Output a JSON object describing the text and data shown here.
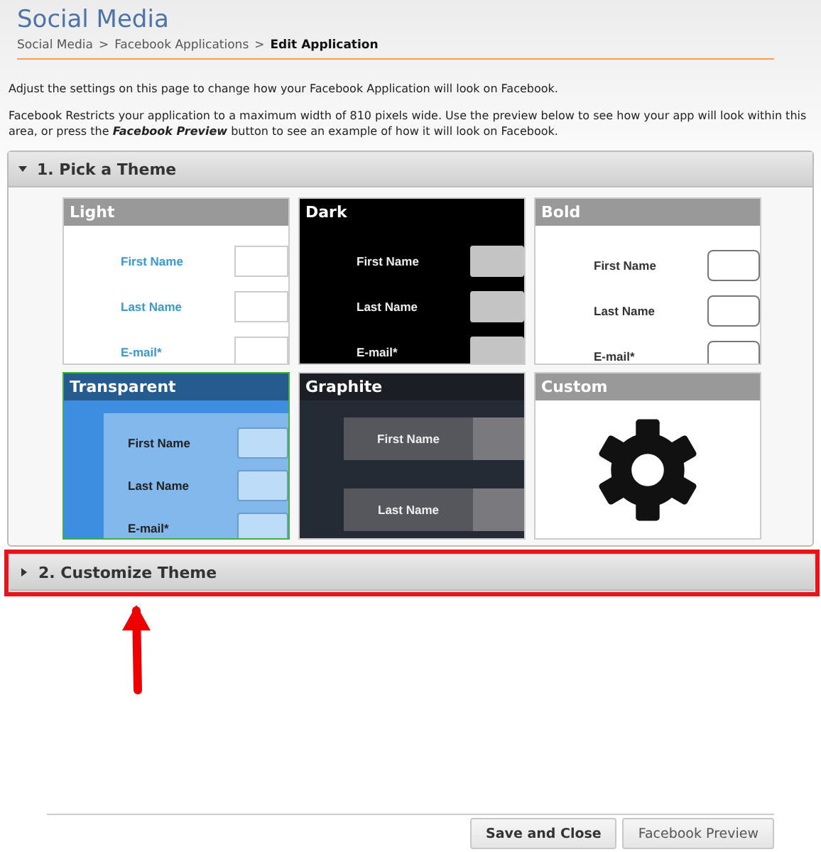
{
  "header": {
    "title": "Social Media",
    "breadcrumb": [
      {
        "label": "Social Media",
        "current": false
      },
      {
        "label": "Facebook Applications",
        "current": false
      },
      {
        "label": "Edit Application",
        "current": true
      }
    ],
    "separator": ">"
  },
  "intro": [
    "Adjust the settings on this page to change how your Facebook Application will look on Facebook.",
    "Facebook Restricts your application to a maximum width of 810 pixels wide. Use the preview below to see how your app will look within this area, or press the **Facebook Preview** button to see an example of how it will look on Facebook."
  ],
  "sections": [
    {
      "title": "1. Pick a Theme",
      "expanded": true,
      "highlighted": false,
      "themes": [
        {
          "name": "Light",
          "kind": "light",
          "selected": false,
          "fields": [
            "First Name",
            "Last Name",
            "E-mail*"
          ]
        },
        {
          "name": "Dark",
          "kind": "dark",
          "selected": false,
          "fields": [
            "First Name",
            "Last Name",
            "E-mail*"
          ]
        },
        {
          "name": "Bold",
          "kind": "bold",
          "selected": false,
          "fields": [
            "First Name",
            "Last Name",
            "E-mail*"
          ]
        },
        {
          "name": "Transparent",
          "kind": "transparent",
          "selected": true,
          "fields": [
            "First Name",
            "Last Name",
            "E-mail*"
          ]
        },
        {
          "name": "Graphite",
          "kind": "graphite",
          "selected": false,
          "fields": [
            "First Name",
            "Last Name"
          ]
        },
        {
          "name": "Custom",
          "kind": "custom",
          "selected": false
        }
      ]
    },
    {
      "title": "2. Customize Theme",
      "expanded": false,
      "highlighted": true
    }
  ],
  "buttons": [
    {
      "label": "Save and Close",
      "primary": true
    },
    {
      "label": "Facebook Preview",
      "primary": false
    }
  ]
}
